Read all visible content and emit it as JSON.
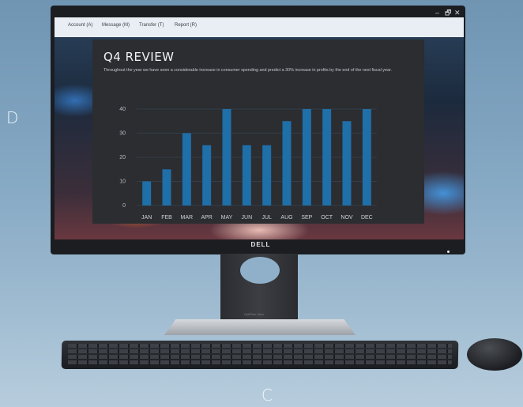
{
  "corner_labels": {
    "top_left": "D",
    "bottom": "C"
  },
  "window": {
    "controls": [
      "–",
      "🗗",
      "✕"
    ],
    "menu": [
      "Account (A)",
      "Message (M)",
      "Transfer (T)",
      "Report (R)"
    ]
  },
  "panel": {
    "title": "Q4 REVIEW",
    "body": "Throughout the year we have seen a considerable increase in consumer spending and predict a 30% increase in profits by the end of the next fiscal year."
  },
  "chart_data": {
    "type": "bar",
    "categories": [
      "JAN",
      "FEB",
      "MAR",
      "APR",
      "MAY",
      "JUN",
      "JUL",
      "AUG",
      "SEP",
      "OCT",
      "NOV",
      "DEC"
    ],
    "values": [
      10,
      15,
      30,
      25,
      40,
      25,
      25,
      35,
      40,
      40,
      35,
      40
    ],
    "ylim": [
      0,
      40
    ],
    "yticks": [
      0,
      10,
      20,
      30,
      40
    ],
    "grid": true,
    "bar_color": "#1f6fa8",
    "background": "#2b2d31"
  },
  "hardware": {
    "logo": "DELL",
    "stand_label": "OptiPlex Ultra"
  }
}
